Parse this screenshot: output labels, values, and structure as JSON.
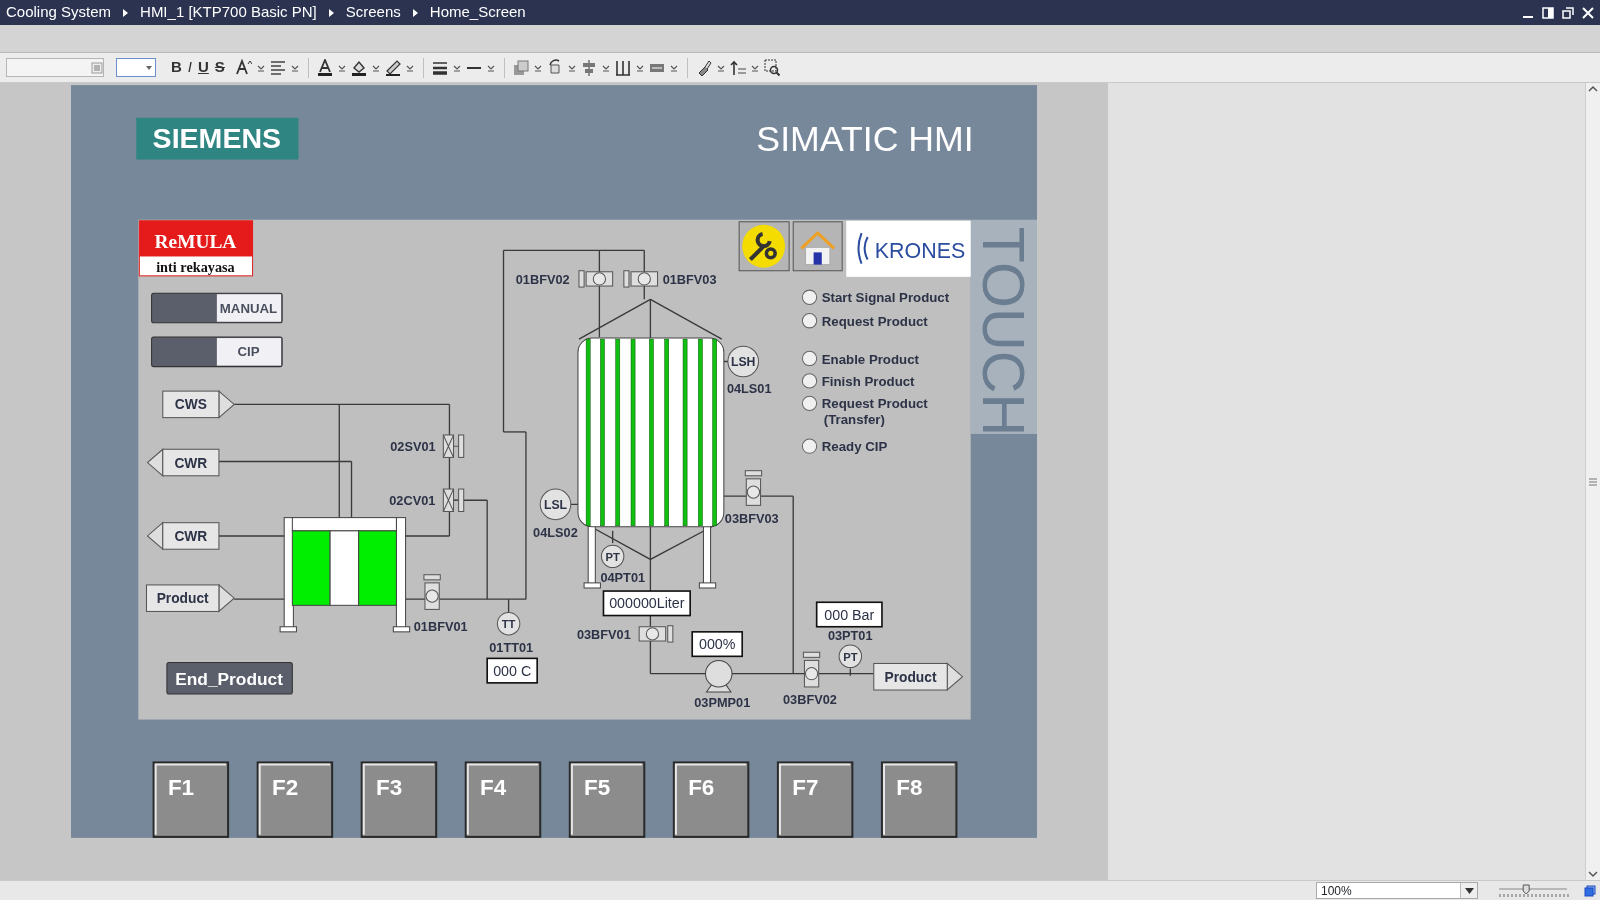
{
  "breadcrumb": [
    {
      "label": "Cooling System"
    },
    {
      "label": "HMI_1 [KTP700 Basic PN]"
    },
    {
      "label": "Screens"
    },
    {
      "label": "Home_Screen"
    }
  ],
  "toolbar": {
    "format_buttons": [
      "B",
      "I",
      "U",
      "S"
    ]
  },
  "device": {
    "brand": "SIEMENS",
    "model": "SIMATIC HMI",
    "side_label": "TOUCH",
    "function_keys": [
      "F1",
      "F2",
      "F3",
      "F4",
      "F5",
      "F6",
      "F7",
      "F8"
    ]
  },
  "screen": {
    "partner_logo": {
      "name": "ReMULA",
      "subtitle": "inti rekayasa"
    },
    "customer_logo": "KRONES",
    "mode_switches": [
      {
        "label": "MANUAL",
        "on": false
      },
      {
        "label": "CIP",
        "on": false
      }
    ],
    "ports": [
      {
        "label": "CWS",
        "kind": "outlet"
      },
      {
        "label": "CWR",
        "kind": "inlet"
      },
      {
        "label": "CWR",
        "kind": "inlet"
      },
      {
        "label": "Product",
        "kind": "outlet"
      },
      {
        "label": "Product",
        "kind": "outlet"
      }
    ],
    "valves": [
      {
        "tag": "01BFV02",
        "kind": "butterfly"
      },
      {
        "tag": "01BFV03",
        "kind": "butterfly"
      },
      {
        "tag": "02SV01",
        "kind": "solenoid"
      },
      {
        "tag": "02CV01",
        "kind": "solenoid"
      },
      {
        "tag": "01BFV01",
        "kind": "butterfly"
      },
      {
        "tag": "03BFV03",
        "kind": "butterfly"
      },
      {
        "tag": "03BFV01",
        "kind": "butterfly"
      },
      {
        "tag": "03BFV02",
        "kind": "butterfly"
      }
    ],
    "instruments": [
      {
        "symbol": "LSH",
        "tag": "04LS01"
      },
      {
        "symbol": "LSL",
        "tag": "04LS02"
      },
      {
        "symbol": "PT",
        "tag": "04PT01"
      },
      {
        "symbol": "TT",
        "tag": "01TT01"
      },
      {
        "symbol": "PT",
        "tag": "03PT01"
      }
    ],
    "readouts": [
      "000000Liter",
      "000 Bar",
      "000%",
      "000 C"
    ],
    "pump": {
      "tag": "03PMP01"
    },
    "signals": [
      {
        "label": "Start Signal Product",
        "on": false
      },
      {
        "label": "Request Product",
        "on": false
      },
      {
        "label": "Enable Product",
        "on": false
      },
      {
        "label": "Finish Product",
        "on": false
      },
      {
        "label": "Request Product (Transfer)",
        "on": false
      },
      {
        "label": "Ready CIP",
        "on": false
      }
    ],
    "end_button": "End_Product"
  },
  "status_bar": {
    "zoom": "100%",
    "zoom_slider": {
      "level": 0.4
    }
  }
}
